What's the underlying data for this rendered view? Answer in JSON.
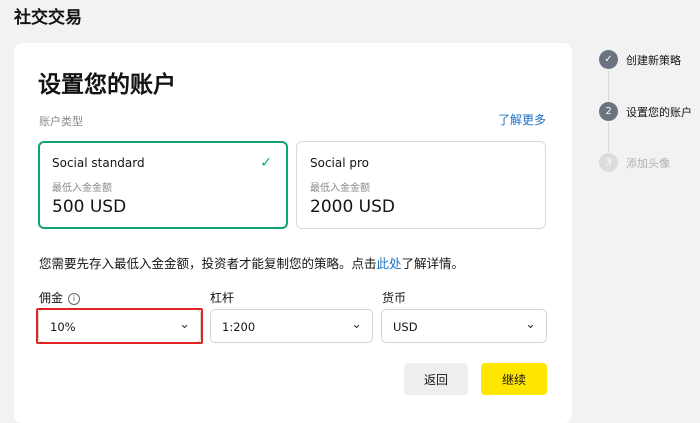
{
  "page_title": "社交交易",
  "card": {
    "title": "设置您的账户",
    "account_type_label": "账户类型",
    "learn_more": "了解更多",
    "options": [
      {
        "name": "Social standard",
        "min_label": "最低入金金额",
        "min_value": "500 USD",
        "selected": true
      },
      {
        "name": "Social pro",
        "min_label": "最低入金金额",
        "min_value": "2000 USD",
        "selected": false
      }
    ],
    "info_text_before": "您需要先存入最低入金金额，投资者才能复制您的策略。点击",
    "info_link": "此处",
    "info_text_after": "了解详情。",
    "fields": {
      "commission": {
        "label": "佣金",
        "value": "10%"
      },
      "leverage": {
        "label": "杠杆",
        "value": "1:200"
      },
      "currency": {
        "label": "货币",
        "value": "USD"
      }
    },
    "buttons": {
      "back": "返回",
      "next": "继续"
    }
  },
  "steps": [
    {
      "number": "✓",
      "label": "创建新策略",
      "state": "done"
    },
    {
      "number": "2",
      "label": "设置您的账户",
      "state": "active"
    },
    {
      "number": "3",
      "label": "添加头像",
      "state": "pending"
    }
  ],
  "colors": {
    "accent_yellow": "#ffe600",
    "selected_green": "#10a66b",
    "link_blue": "#1a73c7",
    "highlight_red": "#e02424"
  }
}
